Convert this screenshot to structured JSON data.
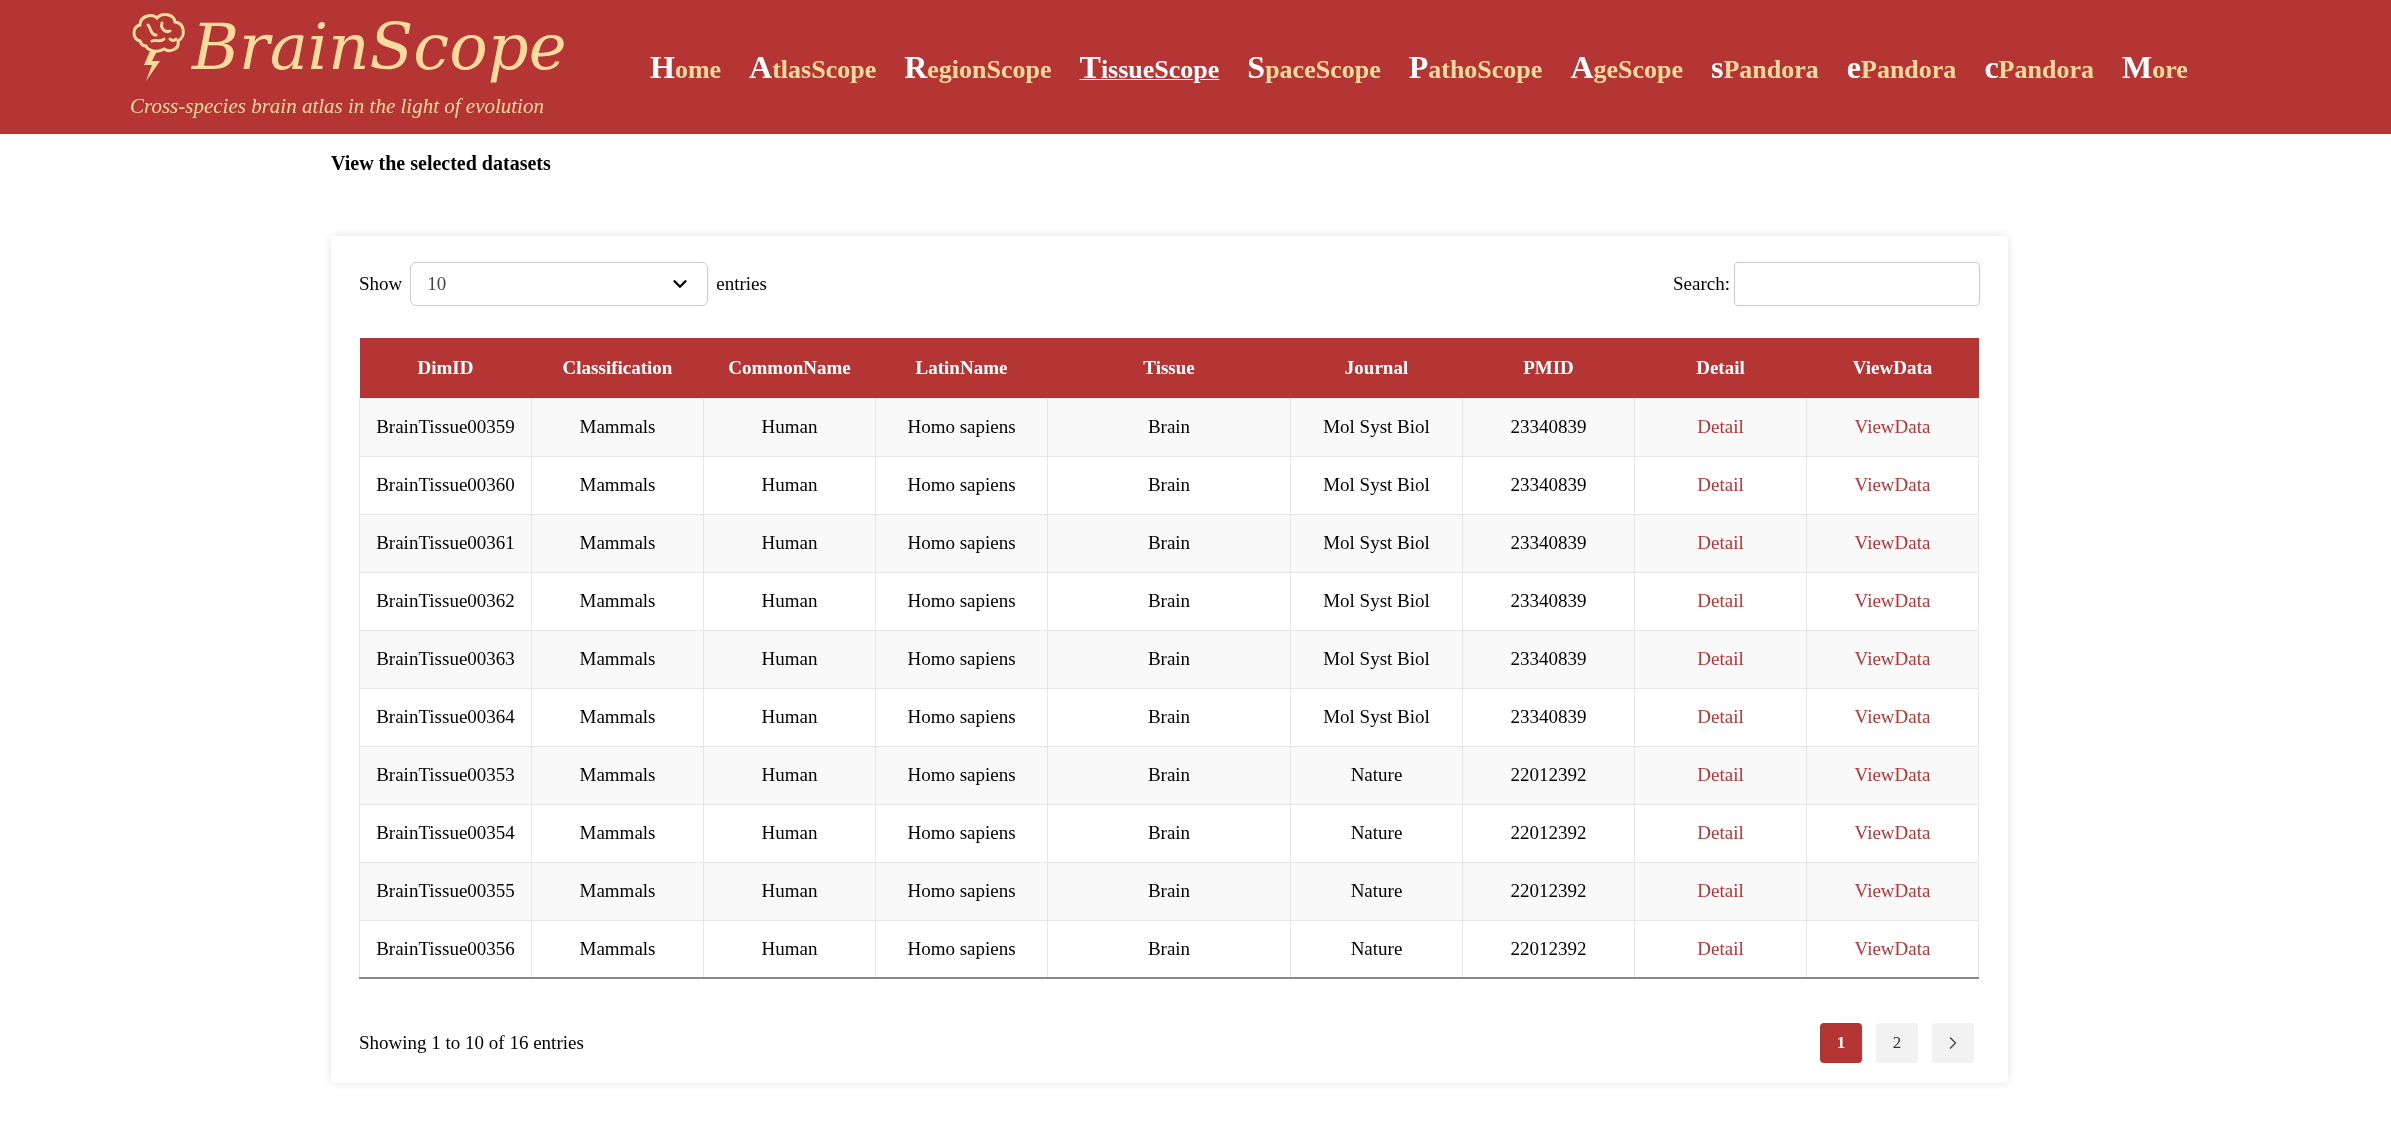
{
  "header": {
    "logo": "BrainScope",
    "tagline": "Cross-species brain atlas in the light of evolution",
    "nav": [
      {
        "initial": "H",
        "rest": "ome",
        "selected": false
      },
      {
        "initial": "A",
        "rest": "tlasScope",
        "selected": false
      },
      {
        "initial": "R",
        "rest": "egionScope",
        "selected": false
      },
      {
        "initial": "T",
        "rest": "issueScope",
        "selected": true
      },
      {
        "initial": "S",
        "rest": "paceScope",
        "selected": false
      },
      {
        "initial": "P",
        "rest": "athoScope",
        "selected": false
      },
      {
        "initial": "A",
        "rest": "geScope",
        "selected": false
      },
      {
        "initial": "s",
        "rest": "Pandora",
        "selected": false
      },
      {
        "initial": "e",
        "rest": "Pandora",
        "selected": false
      },
      {
        "initial": "c",
        "rest": "Pandora",
        "selected": false
      },
      {
        "initial": "M",
        "rest": "ore",
        "selected": false
      }
    ]
  },
  "page_title": "View the selected datasets",
  "controls": {
    "show_label": "Show",
    "page_size": "10",
    "entries_label": "entries",
    "search_label": "Search:"
  },
  "table": {
    "columns": [
      "DimID",
      "Classification",
      "CommonName",
      "LatinName",
      "Tissue",
      "Journal",
      "PMID",
      "Detail",
      "ViewData"
    ],
    "rows": [
      [
        "BrainTissue00359",
        "Mammals",
        "Human",
        "Homo sapiens",
        "Brain",
        "Mol Syst Biol",
        "23340839",
        "Detail",
        "ViewData"
      ],
      [
        "BrainTissue00360",
        "Mammals",
        "Human",
        "Homo sapiens",
        "Brain",
        "Mol Syst Biol",
        "23340839",
        "Detail",
        "ViewData"
      ],
      [
        "BrainTissue00361",
        "Mammals",
        "Human",
        "Homo sapiens",
        "Brain",
        "Mol Syst Biol",
        "23340839",
        "Detail",
        "ViewData"
      ],
      [
        "BrainTissue00362",
        "Mammals",
        "Human",
        "Homo sapiens",
        "Brain",
        "Mol Syst Biol",
        "23340839",
        "Detail",
        "ViewData"
      ],
      [
        "BrainTissue00363",
        "Mammals",
        "Human",
        "Homo sapiens",
        "Brain",
        "Mol Syst Biol",
        "23340839",
        "Detail",
        "ViewData"
      ],
      [
        "BrainTissue00364",
        "Mammals",
        "Human",
        "Homo sapiens",
        "Brain",
        "Mol Syst Biol",
        "23340839",
        "Detail",
        "ViewData"
      ],
      [
        "BrainTissue00353",
        "Mammals",
        "Human",
        "Homo sapiens",
        "Brain",
        "Nature",
        "22012392",
        "Detail",
        "ViewData"
      ],
      [
        "BrainTissue00354",
        "Mammals",
        "Human",
        "Homo sapiens",
        "Brain",
        "Nature",
        "22012392",
        "Detail",
        "ViewData"
      ],
      [
        "BrainTissue00355",
        "Mammals",
        "Human",
        "Homo sapiens",
        "Brain",
        "Nature",
        "22012392",
        "Detail",
        "ViewData"
      ],
      [
        "BrainTissue00356",
        "Mammals",
        "Human",
        "Homo sapiens",
        "Brain",
        "Nature",
        "22012392",
        "Detail",
        "ViewData"
      ]
    ]
  },
  "footer": {
    "info": "Showing 1 to 10 of 16 entries",
    "pages": [
      {
        "label": "1",
        "selected": true
      },
      {
        "label": "2",
        "selected": false
      }
    ]
  }
}
